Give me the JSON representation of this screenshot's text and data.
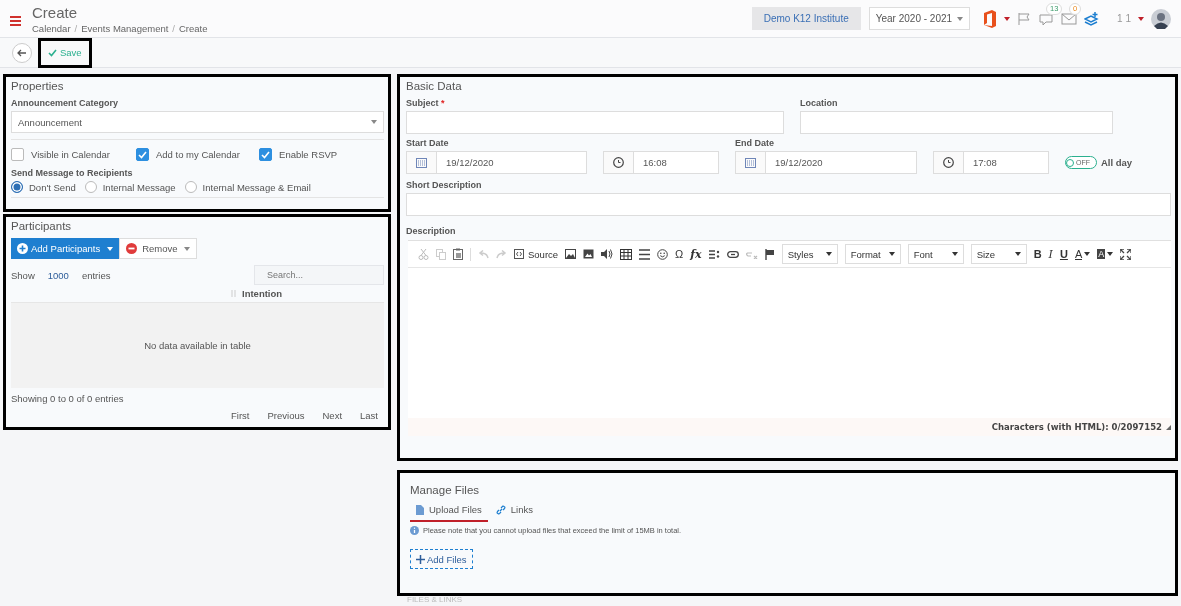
{
  "header": {
    "title": "Create",
    "breadcrumb": [
      "Calendar",
      "Events Management",
      "Create"
    ],
    "breadcrumb_separator": "/",
    "institute": "Demo K12 Institute",
    "year": "Year 2020 - 2021",
    "notifications": "13",
    "messages": "0",
    "user": "1 1"
  },
  "toolbar": {
    "save": "Save"
  },
  "properties": {
    "title": "Properties",
    "category_label": "Announcement Category",
    "category_value": "Announcement",
    "checkboxes": [
      {
        "label": "Visible in Calendar",
        "checked": false
      },
      {
        "label": "Add to my Calendar",
        "checked": true
      },
      {
        "label": "Enable RSVP",
        "checked": true
      }
    ],
    "send_label": "Send Message to Recipients",
    "radios": [
      {
        "label": "Don't Send",
        "selected": true
      },
      {
        "label": "Internal Message",
        "selected": false
      },
      {
        "label": "Internal Message & Email",
        "selected": false
      }
    ]
  },
  "participants": {
    "title": "Participants",
    "add": "Add Participants",
    "remove": "Remove",
    "show": "Show",
    "page_size": "1000",
    "entries": "entries",
    "search_placeholder": "Search...",
    "column": "Intention",
    "empty": "No data available in table",
    "info": "Showing 0 to 0 of 0 entries",
    "pager": [
      "First",
      "Previous",
      "Next",
      "Last"
    ]
  },
  "basic": {
    "title": "Basic Data",
    "subject_label": "Subject",
    "required_mark": "*",
    "location_label": "Location",
    "start_label": "Start Date",
    "start_date": "19/12/2020",
    "start_time": "16:08",
    "end_label": "End Date",
    "end_date": "19/12/2020",
    "end_time": "17:08",
    "all_day": {
      "label": "All day",
      "on": false,
      "state_text": "OFF"
    },
    "short_label": "Short Description",
    "desc_label": "Description",
    "editor": {
      "source": "Source",
      "omega": "Ω",
      "formula": "fx",
      "dropdowns": [
        "Styles",
        "Format",
        "Font",
        "Size"
      ],
      "styles": [
        "B",
        "I",
        "U"
      ],
      "colors": [
        "A",
        "A"
      ],
      "counter": "Characters (with HTML): 0/2097152"
    }
  },
  "files": {
    "title": "Manage Files",
    "tabs": [
      {
        "label": "Upload Files",
        "selected": true
      },
      {
        "label": "Links",
        "selected": false
      }
    ],
    "note": "Please note that you cannot upload files that exceed the limit of 15MB in total.",
    "add": "Add Files",
    "footer": "FILES & LINKS"
  }
}
